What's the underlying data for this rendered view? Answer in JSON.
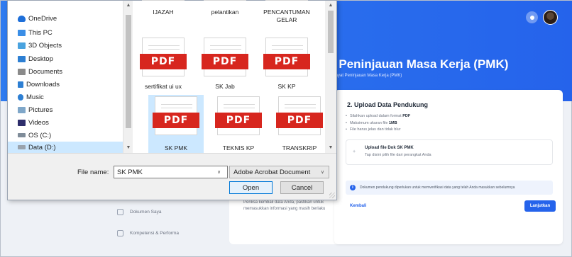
{
  "app": {
    "page_title": "t Peninjauan Masa Kerja (PMK)",
    "page_subtitle": "iwayat Peninjauan Masa Kerja (PMK)",
    "sidebar": [
      {
        "label": "Dokumen Saya",
        "icon": "document-icon"
      },
      {
        "label": "Kompetensi & Performa",
        "icon": "chart-icon"
      }
    ],
    "left_card_text": "Periksa kembali data Anda, pastikan untuk memasukkan informasi yang masih berlaku",
    "card": {
      "title": "2. Upload Data Pendukung",
      "rules": [
        {
          "text": "Silahkan upload dalam format ",
          "bold": "PDF"
        },
        {
          "text": "Maksimum ukuran file ",
          "bold": "1MB"
        },
        {
          "text": "File harus jelas dan tidak blur",
          "bold": ""
        }
      ],
      "upload_title": "Upload file Dok SK PMK",
      "upload_sub": "Tap disini pilih file dari perangkat Anda",
      "info_text": "Dokumen pendukung diperlukan untuk memverifikasi data yang telah Anda masukkan sebelumnya",
      "back_label": "Kembali",
      "next_label": "Lanjutkan"
    }
  },
  "dialog": {
    "nav": [
      {
        "label": "OneDrive",
        "icon": "cloud-icon",
        "color": "#1e6fd9"
      },
      {
        "label": "This PC",
        "icon": "computer-icon",
        "color": "#3a8ee6"
      },
      {
        "label": "3D Objects",
        "icon": "cube-icon",
        "color": "#4aa3df"
      },
      {
        "label": "Desktop",
        "icon": "desktop-icon",
        "color": "#2d7fd3"
      },
      {
        "label": "Documents",
        "icon": "documents-icon",
        "color": "#8a8a8a"
      },
      {
        "label": "Downloads",
        "icon": "download-icon",
        "color": "#2d7fd3"
      },
      {
        "label": "Music",
        "icon": "music-icon",
        "color": "#2d7fd3"
      },
      {
        "label": "Pictures",
        "icon": "pictures-icon",
        "color": "#7fa7c9"
      },
      {
        "label": "Videos",
        "icon": "videos-icon",
        "color": "#2d2d6b"
      },
      {
        "label": "OS (C:)",
        "icon": "drive-icon",
        "color": "#7f8c99"
      },
      {
        "label": "Data (D:)",
        "icon": "drive-icon",
        "color": "#9aa3ad"
      }
    ],
    "selected_nav": "Data (D:)",
    "files": [
      {
        "name": "IJAZAH",
        "icon": "",
        "selected": false
      },
      {
        "name": "pelantikan",
        "icon": "",
        "selected": false
      },
      {
        "name": "PENCANTUMAN GELAR",
        "icon": "",
        "selected": false
      },
      {
        "name": "sertifikat ui ux",
        "icon": "PDF",
        "selected": false
      },
      {
        "name": "SK Jab",
        "icon": "PDF",
        "selected": false
      },
      {
        "name": "SK KP",
        "icon": "PDF",
        "selected": false
      },
      {
        "name": "SK PMK",
        "icon": "PDF",
        "selected": true
      },
      {
        "name": "TEKNIS KP",
        "icon": "PDF",
        "selected": false
      },
      {
        "name": "TRANSKRIP",
        "icon": "PDF",
        "selected": false
      }
    ],
    "file_name_label": "File name:",
    "file_name_value": "SK PMK",
    "file_type": "Adobe Acrobat Document",
    "open_label": "Open",
    "cancel_label": "Cancel"
  }
}
